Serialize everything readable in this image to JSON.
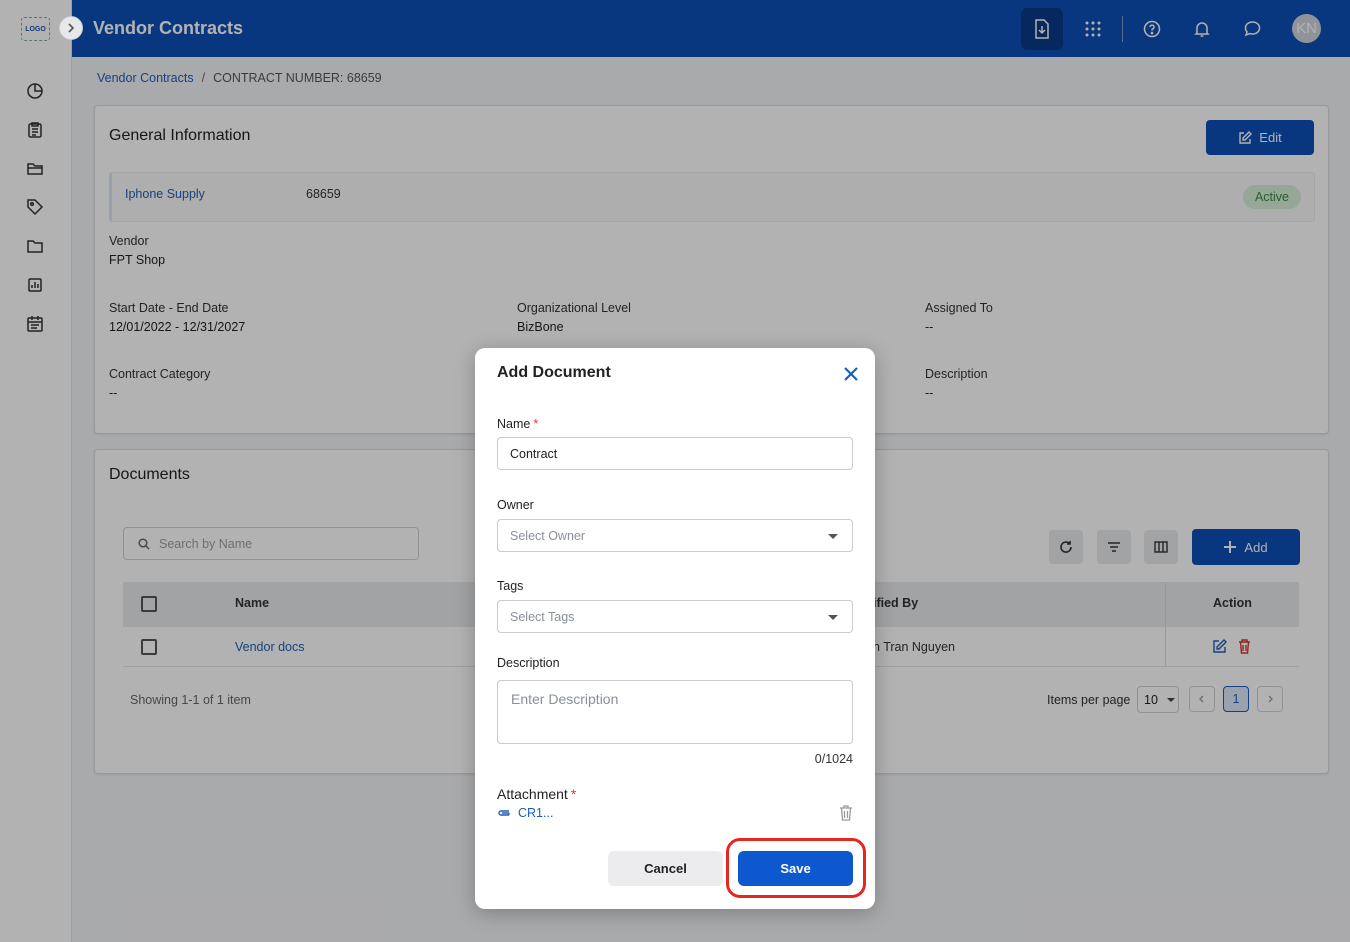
{
  "app": {
    "logo_text": "LOGO",
    "title": "Vendor Contracts",
    "avatar_initials": "KN"
  },
  "breadcrumb": {
    "parent": "Vendor Contracts",
    "separator": "/",
    "current": "CONTRACT NUMBER: 68659"
  },
  "general_info": {
    "title": "General Information",
    "edit_label": "Edit",
    "contract_name": "Iphone Supply",
    "contract_number": "68659",
    "status": "Active",
    "fields": {
      "vendor": {
        "label": "Vendor",
        "value": "FPT Shop"
      },
      "dates": {
        "label": "Start Date - End Date",
        "value": "12/01/2022 - 12/31/2027"
      },
      "org_level": {
        "label": "Organizational Level",
        "value": "BizBone"
      },
      "assigned_to": {
        "label": "Assigned To",
        "value": "--"
      },
      "category": {
        "label": "Contract Category",
        "value": "--"
      },
      "description": {
        "label": "Description",
        "value": "--"
      }
    }
  },
  "documents": {
    "title": "Documents",
    "search_placeholder": "Search by Name",
    "add_label": "Add",
    "columns": {
      "name": "Name",
      "modified_by": "ified By",
      "action": "Action"
    },
    "rows": [
      {
        "name": "Vendor docs",
        "modified_by": "n Tran Nguyen"
      }
    ],
    "showing": "Showing 1-1 of 1 item",
    "items_per_page_label": "Items per page",
    "items_per_page": "10",
    "current_page": "1"
  },
  "modal": {
    "title": "Add Document",
    "name_label": "Name",
    "name_value": "Contract",
    "owner_label": "Owner",
    "owner_placeholder": "Select Owner",
    "tags_label": "Tags",
    "tags_placeholder": "Select Tags",
    "description_label": "Description",
    "description_placeholder": "Enter Description",
    "char_counter": "0/1024",
    "attachment_label": "Attachment",
    "attachment_file": "CR1...",
    "required_marker": "*",
    "cancel_label": "Cancel",
    "save_label": "Save"
  },
  "colors": {
    "brand": "#0d4fb6",
    "primary_button": "#0d58cf",
    "highlight": "#e3281f",
    "active_badge_bg": "#d8efd9",
    "active_badge_text": "#3a8a40"
  },
  "icons": {
    "sidebar": [
      "pie-chart-icon",
      "clipboard-icon",
      "folder-open-icon",
      "tag-icon",
      "folder-icon",
      "report-icon",
      "calendar-icon"
    ],
    "header": [
      "download-document-icon",
      "apps-grid-icon",
      "help-icon",
      "bell-icon",
      "chat-icon"
    ]
  }
}
